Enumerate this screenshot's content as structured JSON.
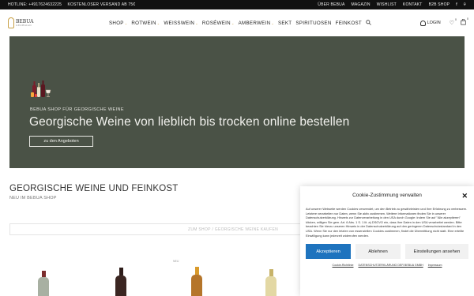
{
  "topbar": {
    "hotline": "HOTLINE: +4917624632225",
    "shipping": "KOSTENLOSER VERSAND AB 75€",
    "links": [
      "ÜBER BEBUA",
      "MAGAZIN",
      "WISHLIST",
      "KONTAKT",
      "B2B SHOP"
    ],
    "social": [
      "f",
      "⌾"
    ]
  },
  "header": {
    "logo_text": "BEBUA",
    "logo_sub": "GEORGIAN",
    "nav": [
      "SHOP",
      "ROTWEIN",
      "WEISSWEIN",
      "ROSÉWEIN",
      "AMBERWEIN",
      "SEKT",
      "SPIRITUOSEN",
      "FEINKOST"
    ],
    "nav_dropdown": [
      true,
      true,
      true,
      true,
      true,
      false,
      false,
      false
    ],
    "login": "LOGIN",
    "wishlist_count": "0",
    "cart_count": "0"
  },
  "hero": {
    "kicker": "BEBUA SHOP FÜR GEORGISCHE WEINE",
    "title": "Georgische Weine von lieblich bis trocken online bestellen",
    "button": "zu den Angeboten",
    "bg_color": "#4a5246"
  },
  "section": {
    "title": "GEORGISCHE WEINE UND FEINKOST",
    "subtitle": "NEU IM BEBUA SHOP",
    "shop_bar": "ZUM SHOP / GEORGISCHE WEINE KAUFEN",
    "badge": "NEU"
  },
  "cookie": {
    "title": "Cookie-Zustimmung verwalten",
    "text": "Auf unserer Webseite werden Cookies verwendet, um den Betrieb zu gewährleisten und Ihre Erfahrung zu verbessern. Letztere verarbeiten nur Daten, wenn Sie aktiv zustimmen. Weitere Informationen finden Sie in unserer Datenschutzerklärung. Hinweis zur Datenverarbeitung in den USA durch Google: Indem Sie auf \"Alle akzeptieren\" klicken, willigen Sie gem. Art. 6 Abs. 1 S. 1 lit. a) DSGVO ein, dass Ihre Daten in den USA verarbeitet werden. Bitte beachten Sie hierzu unseren Hinweis in der Datenschutzerklärung auf den geringeren Datenschutzstandard in den USA. Wenn Sie nur den letzten von essenziellen Cookies zustimmen, findet die Übermittlung nicht statt. Eine erteilte Einwilligung kann jederzeit widerrufen werden.",
    "accept": "Akzeptieren",
    "deny": "Ablehnen",
    "settings": "Einstellungen ansehen",
    "links": [
      "Cookie-Richtlinie",
      "DATENSCHUTZERKLÄRUNG DER BEBUA GMBH",
      "Impressum"
    ],
    "accent": "#1e73be"
  }
}
